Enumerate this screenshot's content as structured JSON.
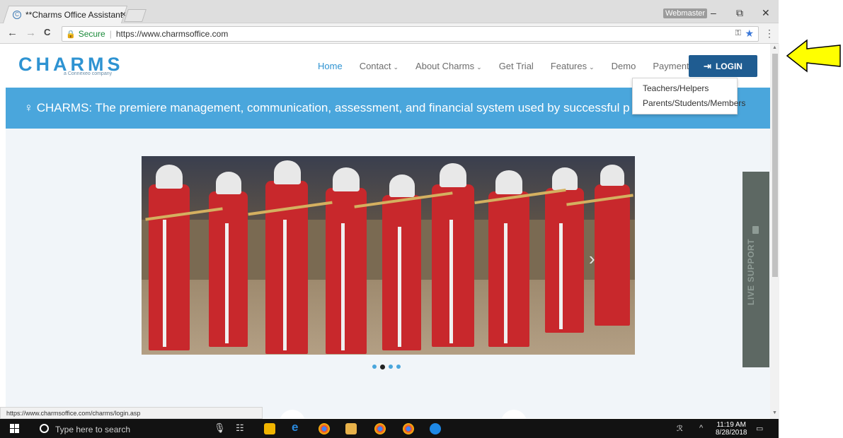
{
  "browser": {
    "tab_title": "**Charms Office Assistant",
    "tab_close": "×",
    "profile_name": "Webmaster",
    "window_minimize": "–",
    "window_restore": "⧉",
    "window_close": "✕",
    "nav_back": "←",
    "nav_forward": "→",
    "nav_reload": "C",
    "security_label": "Secure",
    "url": "https://www.charmsoffice.com",
    "status_url": "https://www.charmsoffice.com/charms/login.asp"
  },
  "site": {
    "logo_text": "CHARMS",
    "logo_subtext": "a Connexeo company",
    "nav_items": [
      {
        "label": "Home",
        "dropdown": false
      },
      {
        "label": "Contact",
        "dropdown": true
      },
      {
        "label": "About Charms",
        "dropdown": true
      },
      {
        "label": "Get Trial",
        "dropdown": false
      },
      {
        "label": "Features",
        "dropdown": true
      },
      {
        "label": "Demo",
        "dropdown": false
      },
      {
        "label": "Payments",
        "dropdown": false
      }
    ],
    "login_label": "LOGIN",
    "login_menu": [
      "Teachers/Helpers",
      "Parents/Students/Members"
    ],
    "banner_text": "CHARMS: The premiere management, communication, assessment, and financial system used by successful p",
    "live_support_label": "LIVE SUPPORT",
    "carousel": {
      "slides": 4,
      "active_slide": 2
    }
  },
  "taskbar": {
    "search_placeholder": "Type here to search",
    "time": "11:19 AM",
    "date": "8/28/2018"
  },
  "colors": {
    "brand": "#2e93d2",
    "banner": "#4aa6dc",
    "login_button": "#1f5c91",
    "annotation_arrow": "#ffff00"
  }
}
